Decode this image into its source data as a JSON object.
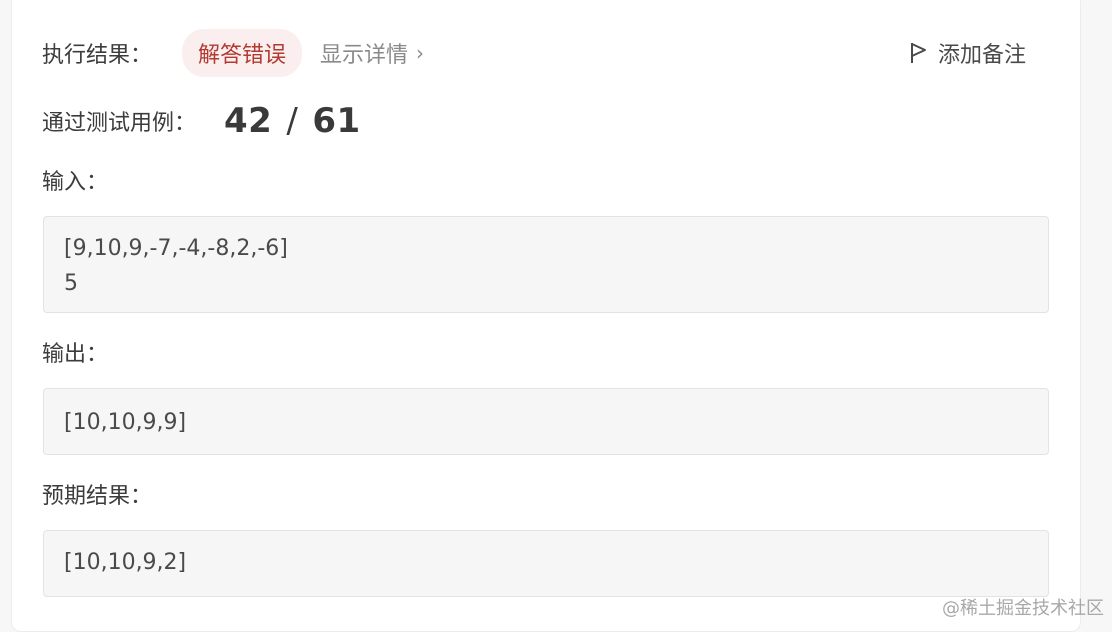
{
  "result": {
    "label": "执行结果：",
    "status": "解答错误",
    "details_link": "显示详情",
    "add_note": "添加备注"
  },
  "testcases": {
    "label": "通过测试用例：",
    "passed": "42",
    "separator": "/",
    "total": "61"
  },
  "input": {
    "label": "输入：",
    "lines": [
      "[9,10,9,-7,-4,-8,2,-6]",
      "5"
    ]
  },
  "output": {
    "label": "输出：",
    "value": "[10,10,9,9]"
  },
  "expected": {
    "label": "预期结果：",
    "value": "[10,10,9,2]"
  },
  "watermark": "@稀土掘金技术社区",
  "colors": {
    "status_text": "#b23a31",
    "status_bg": "#fbeeee",
    "box_bg": "#f6f6f6"
  },
  "icons": {
    "details": "chevron-right-icon",
    "note": "flag-icon"
  }
}
